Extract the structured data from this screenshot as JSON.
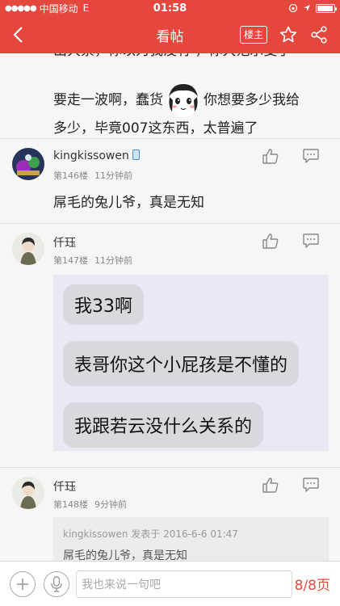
{
  "status_bar": {
    "signal": "●●●●●",
    "carrier": "中国移动",
    "network": "E",
    "time": "01:58",
    "battery_level": 0.95
  },
  "nav": {
    "title": "看帖",
    "louzhu_label": "楼主"
  },
  "first_post": {
    "cut_text": "出大票，你以为我没有   ，你大范示变了",
    "line1_a": "要走一波啊，蠢货",
    "line1_b": "你想要多少我给",
    "line2": "多少，毕竟007这东西，太普遍了"
  },
  "replies": [
    {
      "username": "kingkissowen",
      "floor": "第146楼",
      "time": "11分钟前",
      "text": "屌毛的兔儿爷，真是无知"
    },
    {
      "username": "仟珏",
      "floor": "第147楼",
      "time": "11分钟前",
      "image_bubbles": [
        "我33啊",
        "表哥你这个小屁孩是不懂的",
        "我跟若云没什么关系的"
      ]
    },
    {
      "username": "仟珏",
      "floor": "第148楼",
      "time": "9分钟前",
      "quote_head": "kingkissowen 发表于 2016-6-6 01:47",
      "quote_body": "屌毛的兔儿爷，真是无知"
    }
  ],
  "bottom_bar": {
    "input_placeholder": "我也来说一句吧",
    "page_indicator": "8/8页"
  },
  "colors": {
    "brand": "#e5473d"
  }
}
